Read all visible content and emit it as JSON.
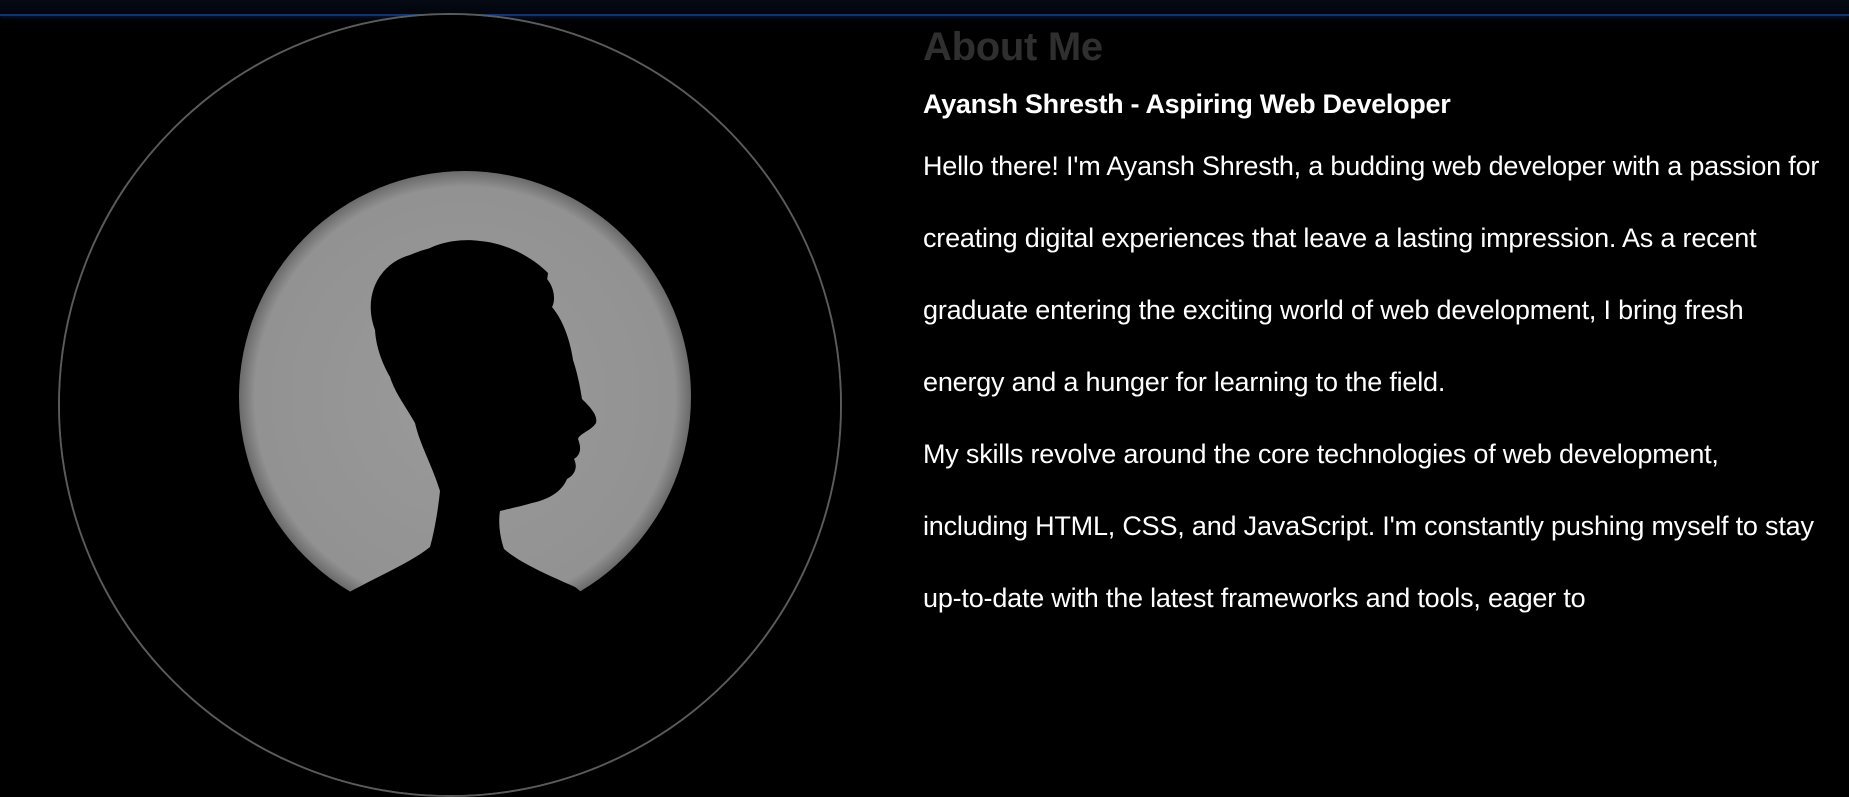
{
  "about": {
    "title": "About Me",
    "subtitle": "Ayansh Shresth - Aspiring Web Developer",
    "paragraphs": [
      "Hello there! I'm Ayansh Shresth, a budding web developer with a passion for creating digital experiences that leave a lasting impression. As a recent graduate entering the exciting world of web development, I bring fresh energy and a hunger for learning to the field.",
      "My skills revolve around the core technologies of web development, including HTML, CSS, and JavaScript. I'm constantly pushing myself to stay up-to-date with the latest frameworks and tools, eager to"
    ]
  },
  "profile_image": {
    "icon": "person-silhouette-icon"
  },
  "colors": {
    "background": "#000000",
    "title": "#2f2f2f",
    "text": "#ffffff",
    "backlight": "#929292",
    "frame": "#5b5b5b",
    "top_border": "#0f3473"
  }
}
